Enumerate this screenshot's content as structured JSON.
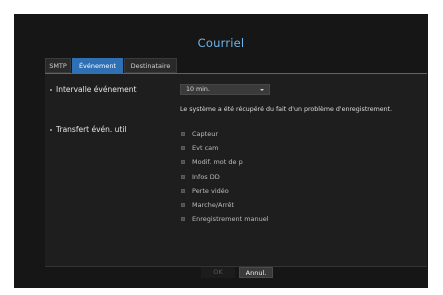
{
  "dialog": {
    "title": "Courriel"
  },
  "tabs": [
    {
      "label": "SMTP",
      "active": false
    },
    {
      "label": "Événement",
      "active": true
    },
    {
      "label": "Destinataire",
      "active": false
    }
  ],
  "event_interval": {
    "label": "Intervalle événement",
    "selected": "10 min.",
    "info": "Le système a été récupéré du fait d'un problème d'enregistrement."
  },
  "transfer": {
    "label": "Transfert évén. util",
    "options": [
      {
        "label": "Capteur",
        "checked": false
      },
      {
        "label": "Evt cam",
        "checked": false
      },
      {
        "label": "Modif. mot de p",
        "checked": false
      },
      {
        "label": "Infos DD",
        "checked": false
      },
      {
        "label": "Perte vidéo",
        "checked": false
      },
      {
        "label": "Marche/Arrêt",
        "checked": false
      },
      {
        "label": "Enregistrement manuel",
        "checked": false
      }
    ]
  },
  "buttons": {
    "ok": "OK",
    "cancel": "Annul."
  },
  "colors": {
    "accent": "#2f6fb3",
    "title": "#6fb4e8",
    "background": "#161616"
  }
}
